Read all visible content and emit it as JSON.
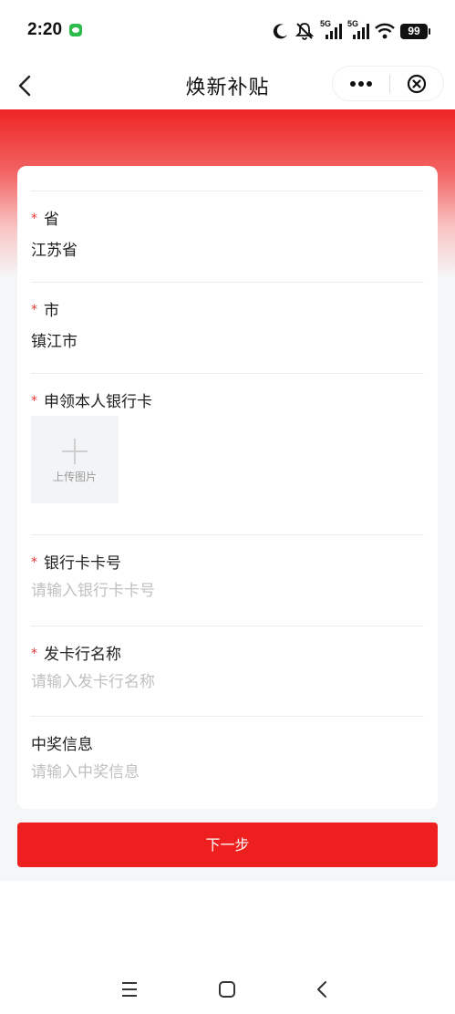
{
  "status_bar": {
    "time": "2:20",
    "icons": [
      "wechat-notification-icon",
      "moon-icon",
      "mute-icon",
      "signal-5g-icon",
      "signal-5g-icon",
      "wifi-icon"
    ],
    "signal_label_1": "5G",
    "signal_label_2": "5G",
    "battery": "99"
  },
  "nav": {
    "title": "焕新补贴",
    "back_icon": "chevron-left-icon",
    "more_icon": "more-dots-icon",
    "close_icon": "close-circle-icon"
  },
  "form": {
    "province": {
      "label": "省",
      "required": true,
      "value": "江苏省"
    },
    "city": {
      "label": "市",
      "required": true,
      "value": "镇江市"
    },
    "bank_card": {
      "label": "申领本人银行卡",
      "required": true,
      "upload_text": "上传图片",
      "icon": "plus-icon"
    },
    "card_number": {
      "label": "银行卡卡号",
      "required": true,
      "placeholder": "请输入银行卡卡号"
    },
    "issuing_bank": {
      "label": "发卡行名称",
      "required": true,
      "placeholder": "请输入发卡行名称"
    },
    "prize_info": {
      "label": "中奖信息",
      "required": false,
      "placeholder": "请输入中奖信息"
    },
    "required_mark": "*"
  },
  "actions": {
    "next_label": "下一步"
  },
  "system_nav": {
    "icons": [
      "menu-icon",
      "home-icon",
      "back-icon"
    ]
  },
  "colors": {
    "brand_red": "#ee1f1f",
    "page_background": "#f5f6f8",
    "placeholder": "#c0c0c0",
    "required_mark": "#e53535"
  }
}
